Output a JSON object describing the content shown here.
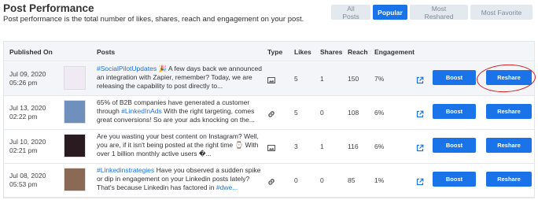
{
  "header": {
    "title": "Post Performance",
    "subtitle": "Post performance is the total number of likes, shares, reach and engagement on your post."
  },
  "filters": [
    {
      "label": "All Posts",
      "active": false
    },
    {
      "label": "Popular",
      "active": true
    },
    {
      "label": "Most Reshared",
      "active": false
    },
    {
      "label": "Most Favorite",
      "active": false
    }
  ],
  "table": {
    "headers": {
      "published": "Published On",
      "posts": "Posts",
      "type": "Type",
      "likes": "Likes",
      "shares": "Shares",
      "reach": "Reach",
      "engagement": "Engagement"
    },
    "rows": [
      {
        "date": "Jul 09, 2020",
        "time": "05:26 pm",
        "post_parts": [
          {
            "t": "#SocialPilotUpdates",
            "tag": true
          },
          {
            "t": " 🎉 A few days back we announced an integration with Zapier, remember? Today, we are releasing the capability to post directly to...",
            "tag": false
          }
        ],
        "type": "image",
        "likes": "5",
        "shares": "1",
        "reach": "150",
        "engagement": "7%",
        "boost": "Boost",
        "reshare": "Reshare",
        "thumb_color": "#f0eaf4"
      },
      {
        "date": "Jul 13, 2020",
        "time": "02:22 pm",
        "post_parts": [
          {
            "t": "65% of B2B companies have generated a customer through ",
            "tag": false
          },
          {
            "t": "#LinkedInAds",
            "tag": true
          },
          {
            "t": " With the right targeting, comes great conversions! So are your ads knocking on the...",
            "tag": false
          }
        ],
        "type": "link",
        "likes": "5",
        "shares": "0",
        "reach": "108",
        "engagement": "6%",
        "boost": "Boost",
        "reshare": "Reshare",
        "thumb_color": "#6f8fbd"
      },
      {
        "date": "Jul 10, 2020",
        "time": "02:21 pm",
        "post_parts": [
          {
            "t": "Are you wasting your best content on Instagram? Well, you are, if it isn't being posted at the right time ⌚ With over 1 billion monthly active users �...",
            "tag": false
          }
        ],
        "type": "image",
        "likes": "3",
        "shares": "1",
        "reach": "116",
        "engagement": "6%",
        "boost": "Boost",
        "reshare": "Reshare",
        "thumb_color": "#2a1b20"
      },
      {
        "date": "Jul 08, 2020",
        "time": "05:53 pm",
        "post_parts": [
          {
            "t": "#Linkedinstrategies",
            "tag": true
          },
          {
            "t": " Have you observed a sudden spike or dip in engagement on your Linkedin posts lately? That's because Linkedin has factored in ",
            "tag": false
          },
          {
            "t": "#dwe...",
            "tag": true
          }
        ],
        "type": "link",
        "likes": "0",
        "shares": "0",
        "reach": "85",
        "engagement": "1%",
        "boost": "Boost",
        "reshare": "Reshare",
        "thumb_color": "#8a6a55"
      }
    ]
  },
  "colors": {
    "accent": "#1a73e8",
    "annotation": "#d21f1f"
  }
}
